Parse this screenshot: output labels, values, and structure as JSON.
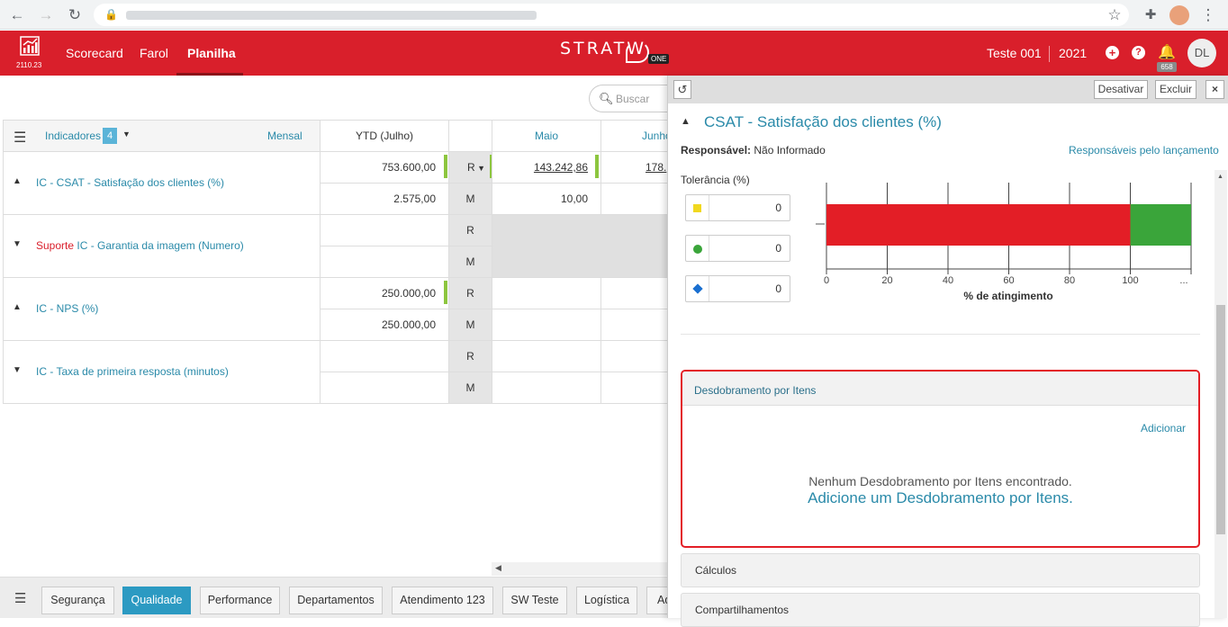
{
  "header": {
    "version": "2110.23",
    "nav": [
      "Scorecard",
      "Farol",
      "Planilha"
    ],
    "active_nav": "Planilha",
    "logo": "STRATW",
    "logo_badge": "ONE",
    "user": "Teste 001",
    "year": "2021",
    "notif_count": "658",
    "avatar": "DL"
  },
  "search": {
    "placeholder": "Buscar"
  },
  "table": {
    "indicators_label": "Indicadores",
    "indicators_count": "4",
    "period": "Mensal",
    "ytd_header": "YTD (Julho)",
    "months": [
      "Maio",
      "Junho"
    ],
    "rows": [
      {
        "name": "IC - CSAT - Satisfação dos clientes (%)",
        "prefix": "",
        "ytd_r": "753.600,00",
        "ytd_m": "2.575,00",
        "r": "R",
        "m": "M",
        "maio_r": "143.242,86",
        "maio_m": "10,00",
        "junho_r": "178.",
        "expanded": true
      },
      {
        "name": "IC - Garantia da imagem (Numero)",
        "prefix": "Suporte ",
        "ytd_r": "",
        "ytd_m": "",
        "r": "R",
        "m": "M",
        "maio_r": "",
        "maio_m": "",
        "expanded": false
      },
      {
        "name": "IC - NPS (%)",
        "prefix": "",
        "ytd_r": "250.000,00",
        "ytd_m": "250.000,00",
        "r": "R",
        "m": "M",
        "maio_r": "",
        "maio_m": "",
        "expanded": true
      },
      {
        "name": "IC - Taxa de primeira resposta (minutos)",
        "prefix": "",
        "ytd_r": "",
        "ytd_m": "",
        "r": "R",
        "m": "M",
        "maio_r": "",
        "maio_m": "",
        "expanded": false
      }
    ]
  },
  "bottom_tabs": [
    "Segurança",
    "Qualidade",
    "Performance",
    "Departamentos",
    "Atendimento 123",
    "SW Teste",
    "Logística",
    "Ad"
  ],
  "active_tab": "Qualidade",
  "panel": {
    "deactivate": "Desativar",
    "delete": "Excluir",
    "title": "CSAT - Satisfação dos clientes (%)",
    "responsible_label": "Responsável:",
    "responsible_value": "Não Informado",
    "responsible_link": "Responsáveis pelo lançamento",
    "tolerance_label": "Tolerância (%)",
    "tolerances": [
      {
        "color": "#f1d81f",
        "shape": "square",
        "value": "0"
      },
      {
        "color": "#3aa53a",
        "shape": "circle",
        "value": "0"
      },
      {
        "color": "#1a6fd0",
        "shape": "diamond",
        "value": "0"
      }
    ],
    "breakdown_title": "Desdobramento por Itens",
    "add_link": "Adicionar",
    "empty_msg": "Nenhum Desdobramento por Itens encontrado.",
    "empty_cta": "Adicione um Desdobramento por Itens.",
    "sections": [
      "Cálculos",
      "Compartilhamentos"
    ]
  },
  "chart_data": {
    "type": "bar",
    "orientation": "horizontal",
    "xlabel": "% de atingimento",
    "ticks": [
      "0",
      "20",
      "40",
      "60",
      "80",
      "100",
      "..."
    ],
    "xlim": [
      0,
      120
    ],
    "segments": [
      {
        "from": 0,
        "to": 100,
        "color": "#e31e26"
      },
      {
        "from": 100,
        "to": 120,
        "color": "#3aa53a"
      }
    ]
  }
}
